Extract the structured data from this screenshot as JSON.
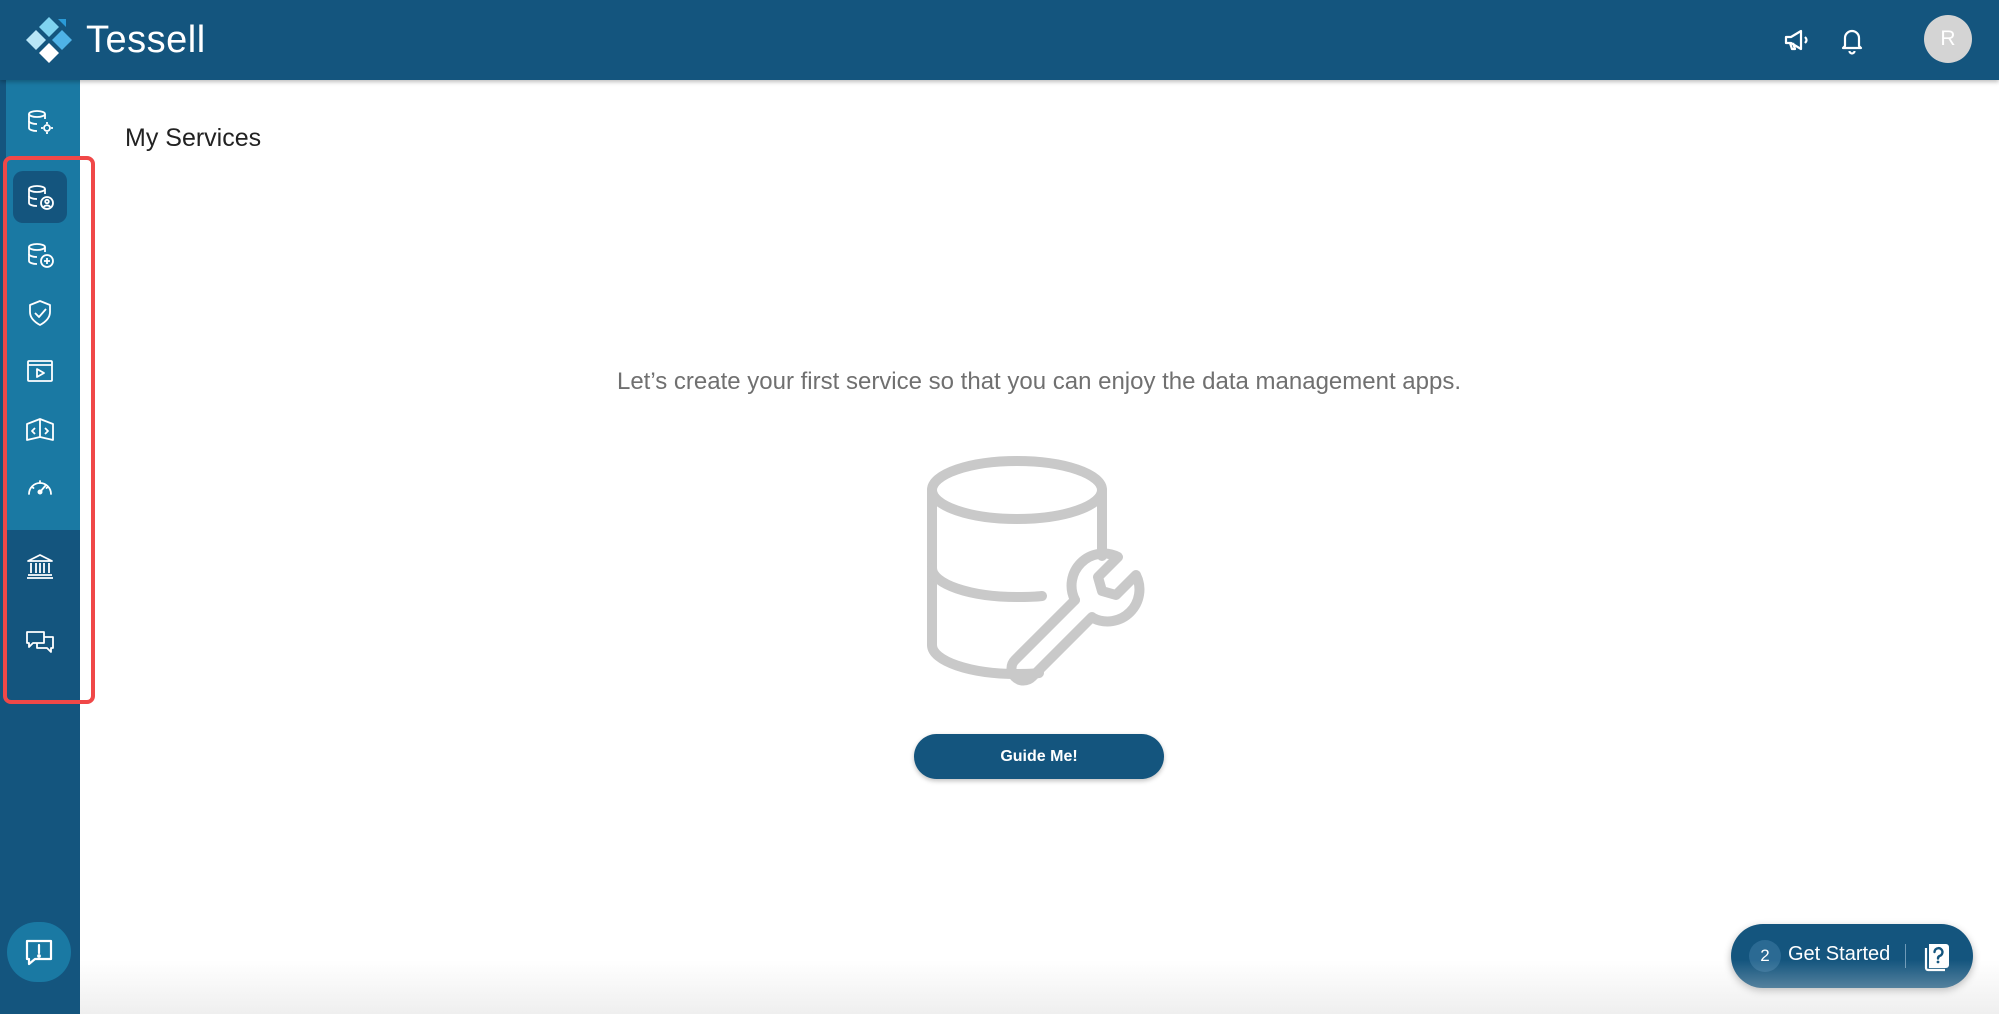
{
  "header": {
    "app_name": "Tessell",
    "logo_icon": "tessell-logo",
    "announcements_icon": "megaphone-icon",
    "notifications_icon": "bell-icon",
    "avatar_initial": "R",
    "brand_color": "#14557e"
  },
  "sidebar": {
    "items": [
      {
        "icon": "database-settings-icon"
      },
      {
        "icon": "database-user-icon",
        "active": true
      },
      {
        "icon": "database-add-icon"
      },
      {
        "icon": "shield-check-icon"
      },
      {
        "icon": "play-screen-icon"
      },
      {
        "icon": "code-book-icon"
      },
      {
        "icon": "speedometer-icon"
      },
      {
        "icon": "bank-icon"
      },
      {
        "icon": "chat-icon"
      }
    ],
    "feedback_icon": "feedback-icon",
    "highlight_color": "#f04848"
  },
  "main": {
    "page_title": "My Services",
    "empty_message": "Let’s create your first service so that you can enjoy the data management apps.",
    "illustration_icon": "database-wrench-icon",
    "guide_button_label": "Guide Me!"
  },
  "get_started": {
    "count": "2",
    "label": "Get Started",
    "icon": "help-book-icon"
  }
}
